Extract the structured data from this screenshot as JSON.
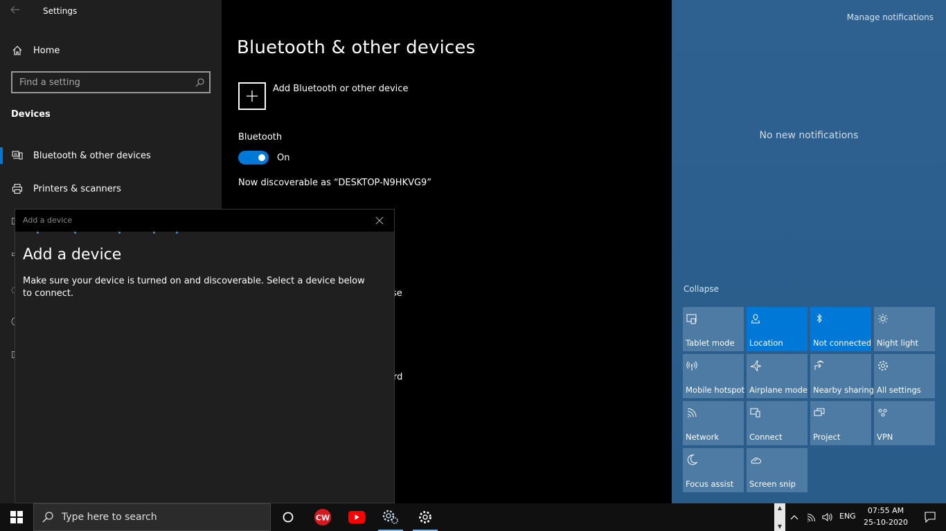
{
  "settings": {
    "app_title": "Settings",
    "home_label": "Home",
    "search_placeholder": "Find a setting",
    "section_title": "Devices",
    "nav_items": [
      {
        "label": "Bluetooth & other devices",
        "icon": "bluetooth-devices-icon",
        "selected": true
      },
      {
        "label": "Printers & scanners",
        "icon": "printer-icon",
        "selected": false
      }
    ]
  },
  "main": {
    "title": "Bluetooth & other devices",
    "add_device_label": "Add Bluetooth or other device",
    "bluetooth_heading": "Bluetooth",
    "bluetooth_state": "On",
    "discoverable_text": "Now discoverable as “DESKTOP-N9HKVG9”",
    "partial_text_1": "se",
    "partial_text_2": "rd"
  },
  "dialog": {
    "caption": "Add a device",
    "title": "Add a device",
    "description": "Make sure your device is turned on and discoverable. Select a device below to connect."
  },
  "action_center": {
    "manage_notifications": "Manage notifications",
    "no_notifications": "No new notifications",
    "collapse_label": "Collapse",
    "tiles": [
      {
        "label": "Tablet mode",
        "icon": "tablet-mode-icon",
        "active": false
      },
      {
        "label": "Location",
        "icon": "location-icon",
        "active": true
      },
      {
        "label": "Not connected",
        "icon": "bluetooth-icon",
        "active": true
      },
      {
        "label": "Night light",
        "icon": "night-light-icon",
        "active": false
      },
      {
        "label": "Mobile hotspot",
        "icon": "mobile-hotspot-icon",
        "active": false
      },
      {
        "label": "Airplane mode",
        "icon": "airplane-icon",
        "active": false
      },
      {
        "label": "Nearby sharing",
        "icon": "nearby-sharing-icon",
        "active": false
      },
      {
        "label": "All settings",
        "icon": "gear-icon",
        "active": false
      },
      {
        "label": "Network",
        "icon": "network-icon",
        "active": false
      },
      {
        "label": "Connect",
        "icon": "connect-icon",
        "active": false
      },
      {
        "label": "Project",
        "icon": "project-icon",
        "active": false
      },
      {
        "label": "VPN",
        "icon": "vpn-icon",
        "active": false
      },
      {
        "label": "Focus assist",
        "icon": "moon-icon",
        "active": false
      },
      {
        "label": "Screen snip",
        "icon": "screen-snip-icon",
        "active": false
      }
    ]
  },
  "taskbar": {
    "search_placeholder": "Type here to search",
    "apps": [
      {
        "name": "cortana",
        "icon": "cortana-icon",
        "running": false
      },
      {
        "name": "cw",
        "icon": "cw-app-icon",
        "running": false
      },
      {
        "name": "youtube",
        "icon": "youtube-icon",
        "running": false
      },
      {
        "name": "settings-alt",
        "icon": "gears-icon",
        "running": true
      },
      {
        "name": "settings",
        "icon": "gear-icon",
        "running": true
      }
    ],
    "language": "ENG",
    "time": "07:55 AM",
    "date": "25-10-2020"
  },
  "colors": {
    "accent": "#0078d7",
    "action_center_bg": "#2d5f8b",
    "tile_inactive": "#4d7ba3"
  }
}
